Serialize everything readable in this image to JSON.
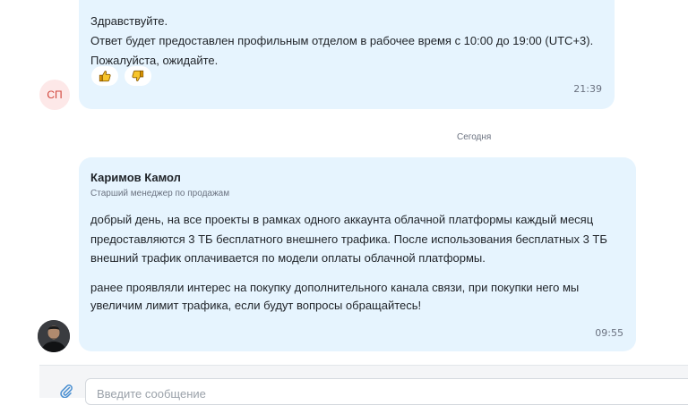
{
  "messages": [
    {
      "avatar_initials": "СП",
      "lines": [
        "Здравствуйте.",
        "Ответ будет предоставлен профильным отделом в рабочее время с 10:00 до 19:00 (UTC+3).",
        "Пожалуйста, ожидайте."
      ],
      "reactions": [
        "thumbs-up-icon",
        "thumbs-down-icon"
      ],
      "time": "21:39"
    },
    {
      "author": "Каримов Камол",
      "role": "Старший менеджер по продажам",
      "lines": [
        "добрый день, на все проекты в рамках одного аккаунта облачной платформы каждый месяц",
        "предоставляются 3 ТБ бесплатного внешнего трафика. После использования бесплатных 3 ТБ",
        "внешний трафик оплачивается по модели оплаты облачной платформы.",
        "ранее проявляли интерес на покупку дополнительного канала связи, при покупки него мы",
        "увеличим лимит трафика, если будут вопросы обращайтесь!"
      ],
      "time": "09:55"
    }
  ],
  "date_separator": "Сегодня",
  "composer": {
    "placeholder": "Введите сообщение",
    "attach_icon": "paperclip-icon"
  },
  "colors": {
    "bubble": "#e6f4fe",
    "initials_bg": "#fde8e8",
    "initials_text": "#d1453b",
    "muted": "#6b7280"
  }
}
